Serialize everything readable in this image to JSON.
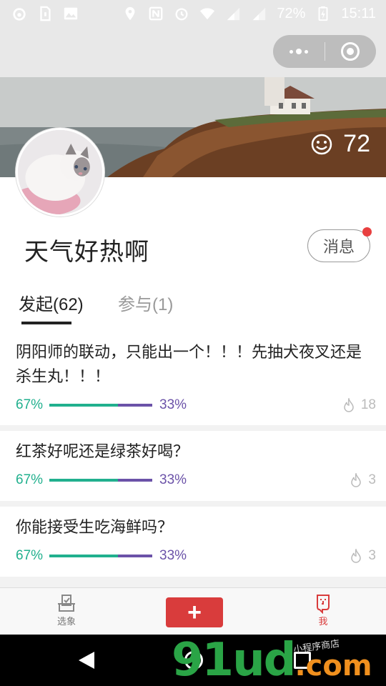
{
  "status_bar": {
    "battery": "72%",
    "time": "15:11",
    "icons": [
      "weibo-icon",
      "sim-icon",
      "image-icon",
      "location-icon",
      "nfc-icon",
      "alarm-icon",
      "wifi-icon",
      "signal-icon",
      "signal-icon",
      "battery-charging-icon"
    ]
  },
  "capsule": {
    "menu_icon": "more-dots-icon",
    "close_icon": "target-circle-icon"
  },
  "profile": {
    "likes": "72",
    "like_icon": "smiley-icon",
    "username": "天气好热啊",
    "message_button": "消息",
    "has_unread": true
  },
  "tabs": [
    {
      "label": "发起(62)",
      "active": true
    },
    {
      "label": "参与(1)",
      "active": false
    }
  ],
  "polls": [
    {
      "title": "阴阳师的联动，只能出一个！！！先抽犬夜叉还是杀生丸！！！",
      "option_a_pct": "67%",
      "option_b_pct": "33%",
      "option_a_value": 67,
      "hot": "18"
    },
    {
      "title": "红茶好呢还是绿茶好喝？",
      "option_a_pct": "67%",
      "option_b_pct": "33%",
      "option_a_value": 67,
      "hot": "3"
    },
    {
      "title": "你能接受生吃海鲜吗？",
      "option_a_pct": "67%",
      "option_b_pct": "33%",
      "option_a_value": 67,
      "hot": "3"
    }
  ],
  "tabbar": {
    "left_label": "选象",
    "center_label": "+",
    "right_label": "我"
  },
  "watermark": {
    "main": "91ud",
    "tld": ".com",
    "sub": "小程序商店"
  },
  "colors": {
    "accent_red": "#d93c3c",
    "option_a": "#21b08e",
    "option_b": "#6b52a8"
  }
}
